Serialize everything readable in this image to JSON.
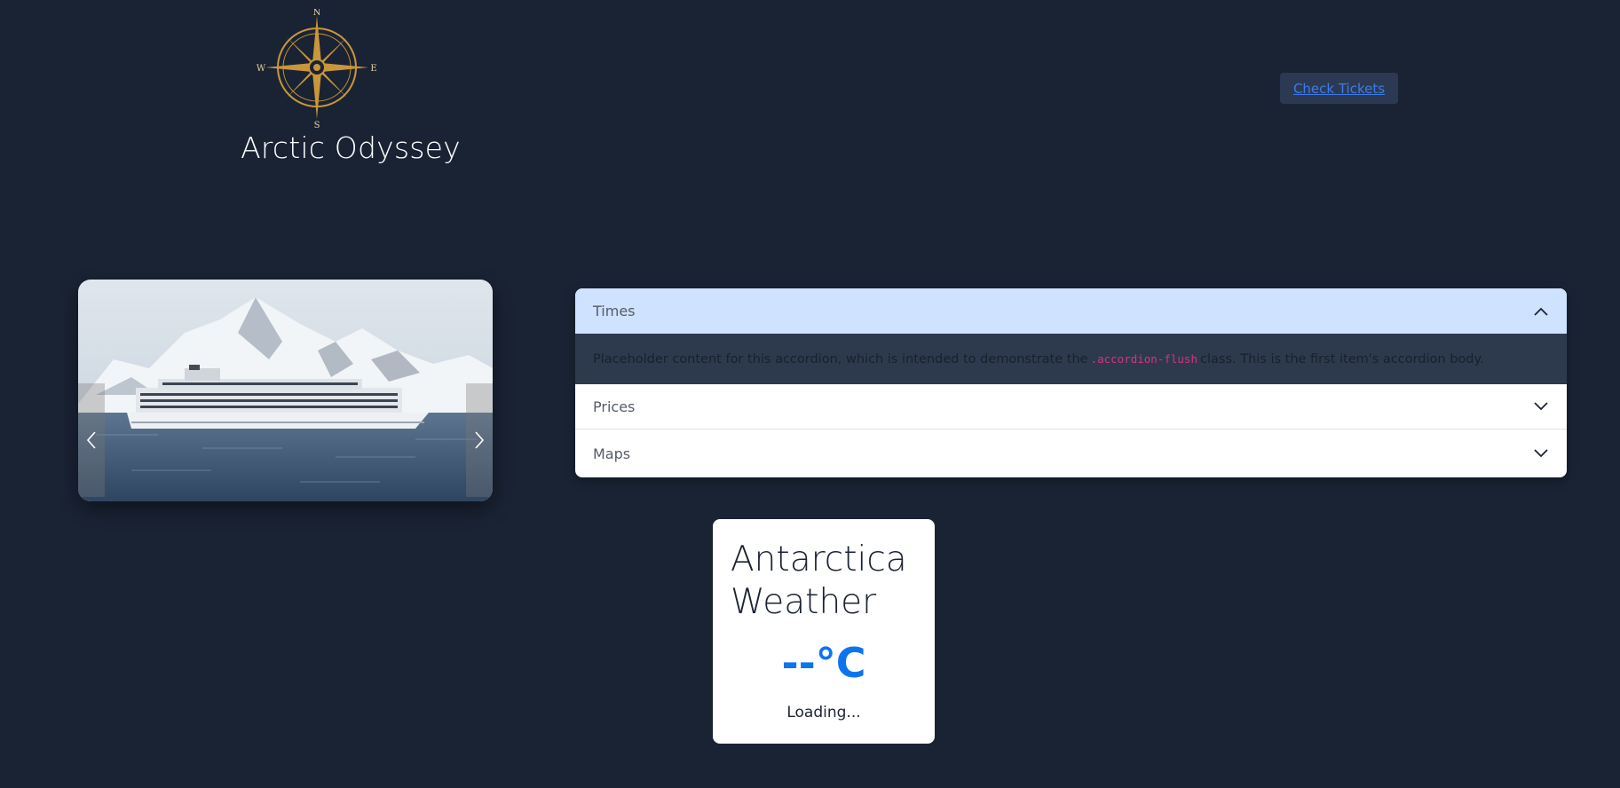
{
  "brand": {
    "title": "Arctic Odyssey",
    "logo_icon": "compass-rose-icon",
    "compass": {
      "n": "N",
      "e": "E",
      "s": "S",
      "w": "W"
    },
    "logo_color": "#c9973a"
  },
  "header": {
    "tickets_label": "Check Tickets"
  },
  "carousel": {
    "image_alt": "cruise-ship-antarctica-image",
    "prev_icon": "chevron-left-icon",
    "next_icon": "chevron-right-icon"
  },
  "accordion": {
    "items": [
      {
        "label": "Times",
        "expanded": true,
        "icon": "chevron-up-icon"
      },
      {
        "label": "Prices",
        "expanded": false,
        "icon": "chevron-down-icon"
      },
      {
        "label": "Maps",
        "expanded": false,
        "icon": "chevron-down-icon"
      }
    ],
    "body": {
      "before": "Placeholder content for this accordion, which is intended to demonstrate the",
      "code": ".accordion-flush",
      "after": "class. This is the first item's accordion body."
    }
  },
  "weather": {
    "title": "Antarctica Weather",
    "temperature": "--°C",
    "status": "Loading..."
  },
  "colors": {
    "background": "#1a2334",
    "accent": "#0d74f0",
    "active_header": "#cfe2ff",
    "code": "#d63384"
  }
}
